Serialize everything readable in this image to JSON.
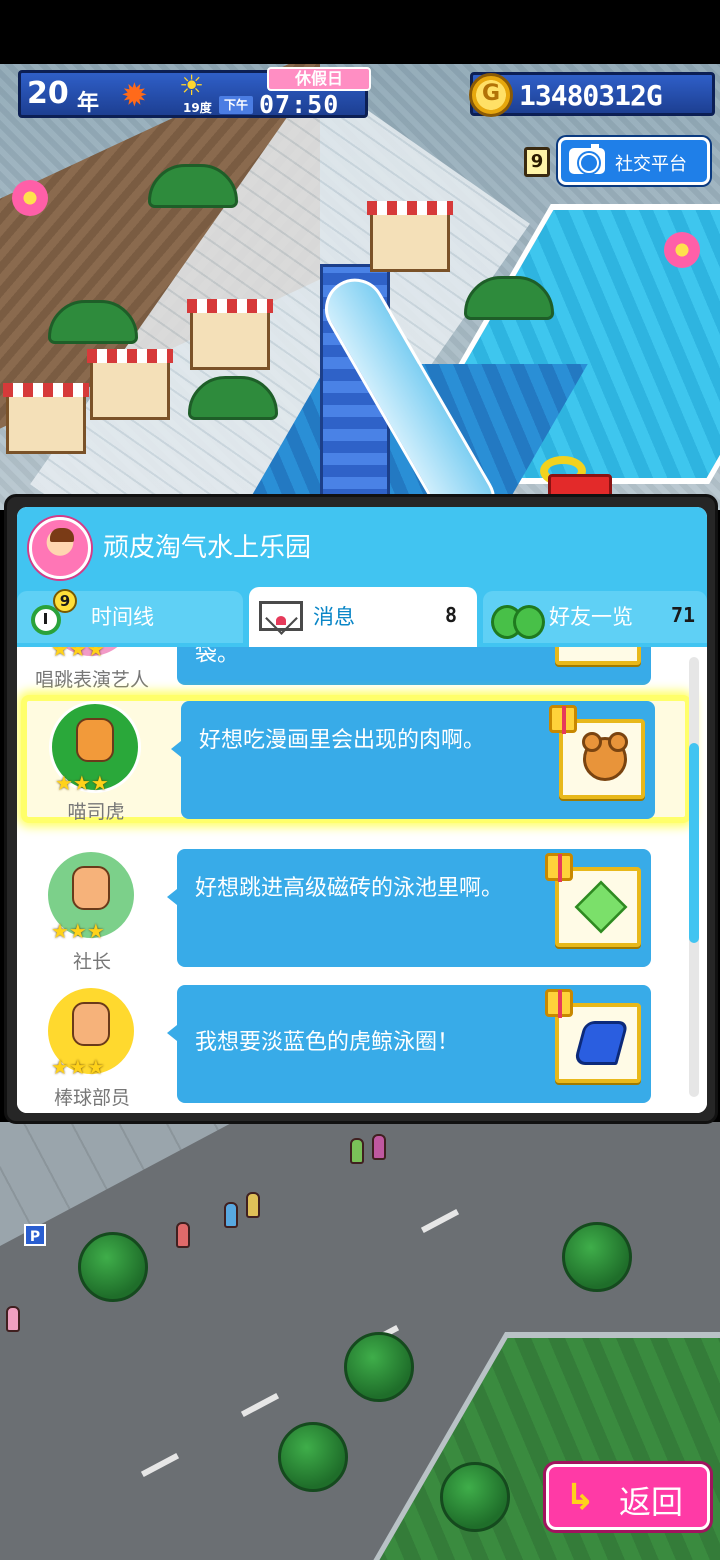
{
  "hud": {
    "year_number": "20",
    "year_unit": "年",
    "season_icon": "maple-leaf-icon",
    "weather_icon": "sun-icon",
    "temperature": "19度",
    "holiday": "休假日",
    "ampm": "下午",
    "time": "07:50",
    "gold_icon_letter": "G",
    "gold_amount": "13480312G"
  },
  "social": {
    "badge_count": "9",
    "label": "社交平台"
  },
  "panel": {
    "park_name": "顽皮淘气水上乐园",
    "tabs": [
      {
        "label": "时间线",
        "badge": "9",
        "count": ""
      },
      {
        "label": "消息",
        "badge": "",
        "count": "8"
      },
      {
        "label": "好友一览",
        "badge": "",
        "count": "71"
      }
    ]
  },
  "messages": [
    {
      "name": "唱跳表演艺人",
      "text": "袋。",
      "stars": "★★★",
      "gift_item": "partial-item"
    },
    {
      "name": "喵司虎",
      "text": "好想吃漫画里会出现的肉啊。",
      "stars": "★★★",
      "gift_item": "bear-item"
    },
    {
      "name": "社长",
      "text": "好想跳进高级磁砖的泳池里啊。",
      "stars": "★★★",
      "gift_item": "tile-item"
    },
    {
      "name": "棒球部员",
      "text": "我想要淡蓝色的虎鲸泳圈！",
      "stars": "★★★",
      "gift_item": "float-item"
    }
  ],
  "back_button": {
    "label": "返回",
    "icon": "back-arrow-icon"
  },
  "colors": {
    "panel_header": "#41c4f1",
    "bubble": "#38abe8",
    "highlight": "#ffff6a",
    "back_button": "#ff3aa6"
  }
}
